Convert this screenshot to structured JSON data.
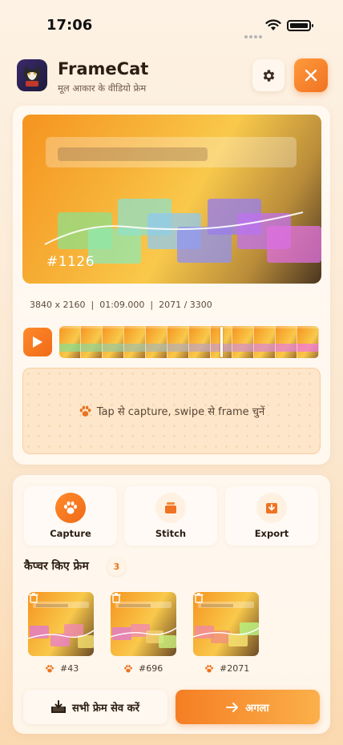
{
  "status_bar": {
    "time": "17:06"
  },
  "header": {
    "title": "FrameCat",
    "subtitle": "मूल आकार के वीडियो फ्रेम",
    "app_icon": "cat-app-icon",
    "settings_icon": "gear-icon",
    "close_icon": "close-icon"
  },
  "preview": {
    "frame_label": "#1126"
  },
  "meta": {
    "resolution": "3840 x 2160",
    "timestamp": "01:09.000",
    "frame_position": "2071 / 3300"
  },
  "timeline": {
    "play_icon": "play-icon",
    "playhead_progress": 0.624
  },
  "capture_zone": {
    "hint": "Tap से capture, swipe से frame चुनें",
    "icon": "paw-icon"
  },
  "actions": [
    {
      "label": "Capture",
      "icon": "paw-icon"
    },
    {
      "label": "Stitch",
      "icon": "stack-icon"
    },
    {
      "label": "Export",
      "icon": "export-icon"
    }
  ],
  "captured_section": {
    "title": "कैप्चर किए फ्रेम",
    "count": "3"
  },
  "captured_frames": [
    {
      "label": "#43"
    },
    {
      "label": "#696"
    },
    {
      "label": "#2071"
    }
  ],
  "footer": {
    "save_all_label": "सभी फ्रेम सेव करें",
    "next_label": "अगला"
  },
  "colors": {
    "accent": "#f07222",
    "accent_light": "#fbb04a",
    "background": "#fdf2e4"
  }
}
